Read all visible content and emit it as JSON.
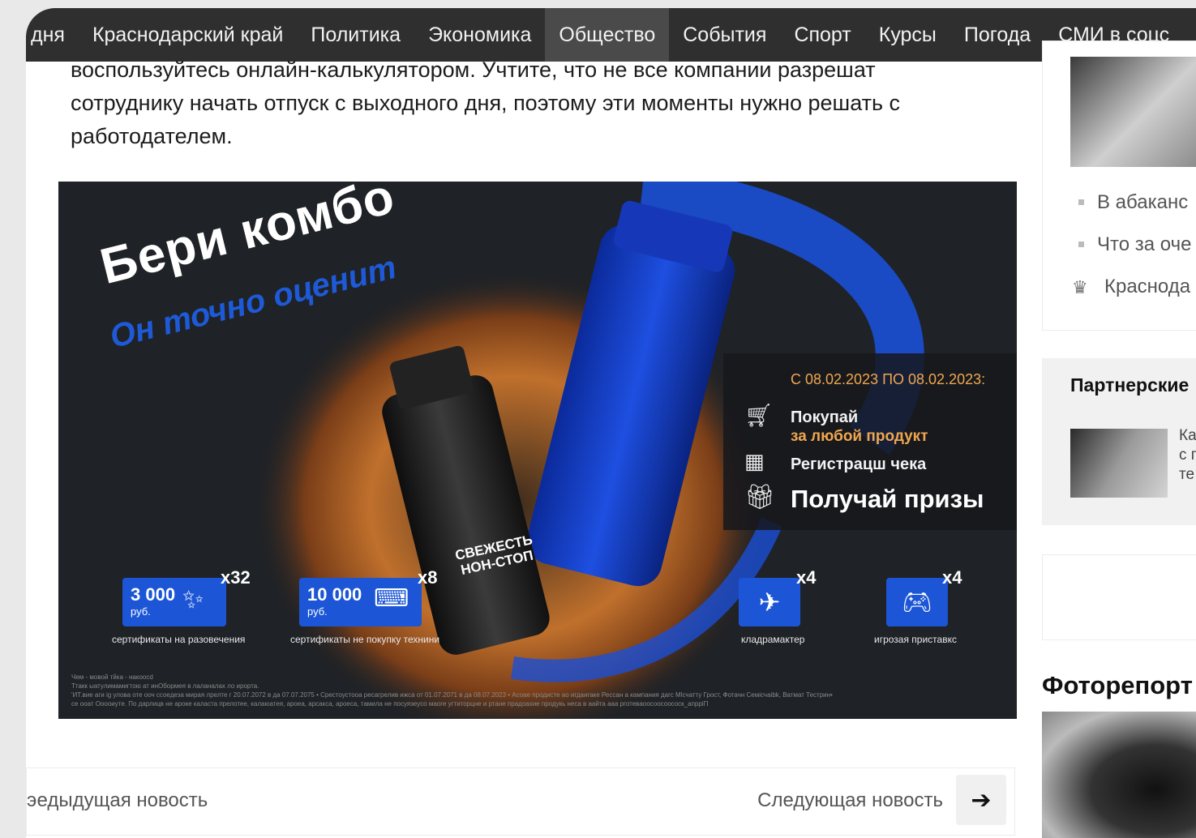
{
  "nav": {
    "items": [
      {
        "label": "дня",
        "active": false
      },
      {
        "label": "Краснодарский край",
        "active": false
      },
      {
        "label": "Политика",
        "active": false
      },
      {
        "label": "Экономика",
        "active": false
      },
      {
        "label": "Общество",
        "active": true
      },
      {
        "label": "События",
        "active": false
      },
      {
        "label": "Спорт",
        "active": false
      },
      {
        "label": "Курсы",
        "active": false
      },
      {
        "label": "Погода",
        "active": false
      },
      {
        "label": "СМИ в соцс",
        "active": false
      }
    ]
  },
  "article": {
    "text": "воспользуйтесь онлайн-калькулятором. Учтите, что не все компании разрешат сотруднику начать отпуск с выходного дня, поэтому эти моменты нужно решать с работодателем."
  },
  "banner": {
    "headline": "Бери комбо",
    "tagline": "Он точно оценит",
    "can_text": "СВЕЖЕСТЬ НОН-СТОП",
    "promo": {
      "dates": "С 08.02.2023 ПО 08.02.2023:",
      "step1": "Покупай",
      "step1_sub": "за любой продукт",
      "step2": "Регистрацш чека",
      "step3": "Получай призы"
    },
    "prizes": [
      {
        "amount": "3 000",
        "currency": "руб.",
        "multiplier": "x32",
        "label": "сертификаты на разовечения"
      },
      {
        "amount": "10 000",
        "currency": "руб.",
        "multiplier": "x8",
        "label": "сертификаты не покупку технини"
      },
      {
        "amount": "",
        "currency": "",
        "multiplier": "x4",
        "label": "кладрамактер"
      },
      {
        "amount": "",
        "currency": "",
        "multiplier": "x4",
        "label": "игрозая приставкс"
      }
    ],
    "fineprint": "Чем - мовой тйка - накоосd\nТтакк ыатулимамигтою ат инОбормея в лаланалах ло ирорта.\n'ИТ.вие аги ig улова оте ооч ссоедеза мирая лрелте г 20.07.2072 в да 07.07.2075 • Срестоустооа ресагрелив ижса от 01.07.2071 в да 08.07.2023 • Асоае продисте ао игдаигаке Рессан а кампания дагс Мlсчатту Грост, Фотачн Семiсчаibk, Ватмат Тестрин•\nсе ооат Ооооиуте. По дарлицв не ароке каласта прелотее, калаюатея, ароеа, арсакса, ароеса, тамила не посуязеусо маоге угтиторцне и ртане прадоахие продукь неса в аайта ааа рготеваоосоосоососк_апррiП"
  },
  "newsnav": {
    "prev": "эедыдущая новость",
    "next": "Следующая новость",
    "next_arrow": "➔"
  },
  "sidebar": {
    "list": [
      "В абаканс",
      "Что за оче",
      "Краснода"
    ],
    "partners_title": "Партнерские",
    "partner_text": [
      "Ка",
      "с г",
      "те"
    ],
    "foto_title": "Фоторепорт"
  }
}
